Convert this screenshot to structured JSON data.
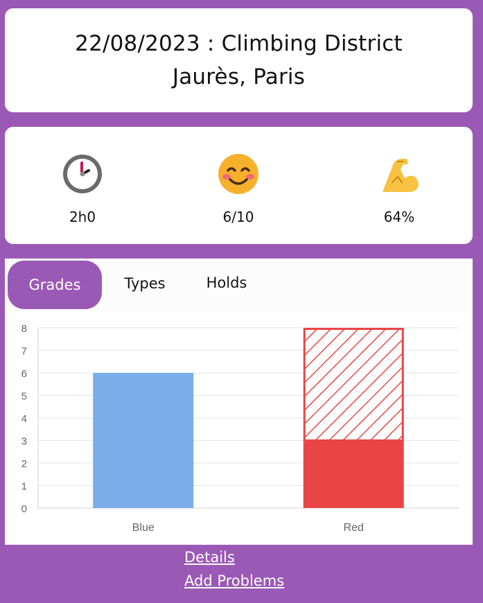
{
  "header": {
    "title": "22/08/2023 : Climbing District Jaurès, Paris"
  },
  "stats": [
    {
      "icon": "clock-icon",
      "value": "2h0"
    },
    {
      "icon": "smiling-face-icon",
      "value": "6/10"
    },
    {
      "icon": "flexed-biceps-icon",
      "value": "64%"
    }
  ],
  "tabs": [
    {
      "label": "Grades",
      "active": true
    },
    {
      "label": "Types",
      "active": false
    },
    {
      "label": "Holds",
      "active": false
    }
  ],
  "chart_data": {
    "type": "bar",
    "categories": [
      "Blue",
      "Red"
    ],
    "series": [
      {
        "values": [
          6,
          3
        ],
        "style": "solid"
      },
      {
        "values": [
          0,
          5
        ],
        "style": "hatched"
      }
    ],
    "colors": {
      "Blue": "#7aade9",
      "Red": "#ea4545"
    },
    "ylim": [
      0,
      8
    ],
    "yticks": [
      "0",
      "1",
      "2",
      "3",
      "4",
      "5",
      "6",
      "7",
      "8"
    ],
    "grid": true,
    "stacked": true
  },
  "links": {
    "details": "Details",
    "add_problems": "Add Problems"
  }
}
